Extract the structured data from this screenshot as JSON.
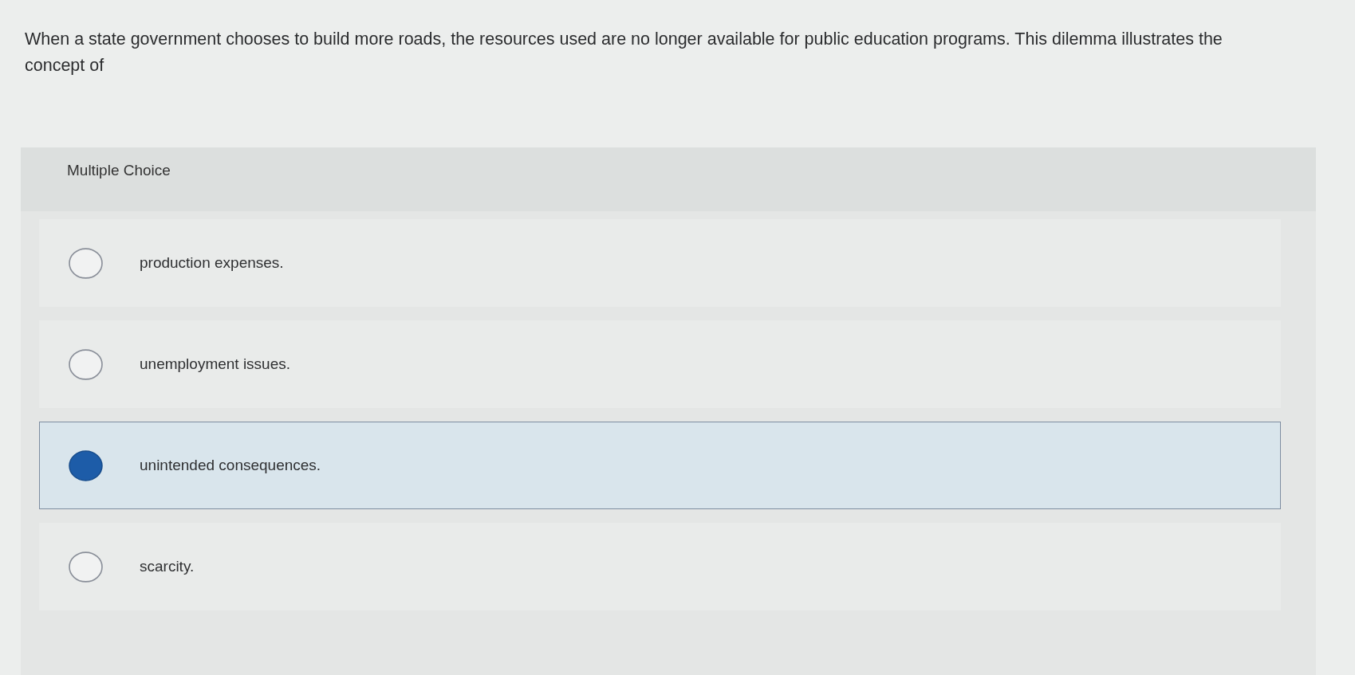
{
  "question": {
    "text": "When a state government chooses to build more roads, the resources used are no longer available for public education programs. This dilemma illustrates the concept of"
  },
  "multiple_choice": {
    "label": "Multiple Choice",
    "options": [
      {
        "text": "production expenses.",
        "selected": false
      },
      {
        "text": "unemployment issues.",
        "selected": false
      },
      {
        "text": "unintended consequences.",
        "selected": true
      },
      {
        "text": "scarcity.",
        "selected": false
      }
    ]
  }
}
